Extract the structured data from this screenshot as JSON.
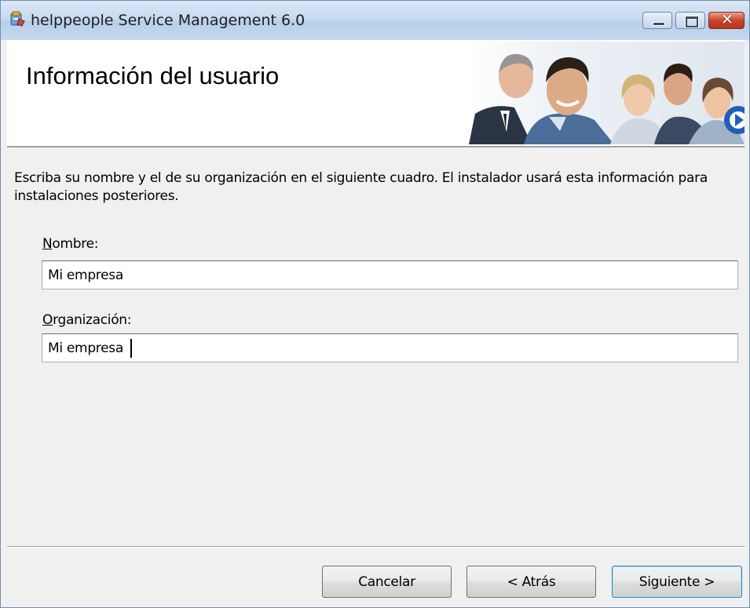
{
  "window": {
    "title": "helppeople Service Management 6.0"
  },
  "banner": {
    "title": "Información del usuario"
  },
  "instructions": "Escriba su nombre y el de su organización en el siguiente cuadro. El instalador usará esta información para instalaciones posteriores.",
  "form": {
    "name_label": {
      "accel": "N",
      "rest": "ombre:"
    },
    "name_value": "Mi empresa",
    "org_label": {
      "accel": "O",
      "rest": "rganización:"
    },
    "org_value": "Mi empresa"
  },
  "buttons": {
    "cancel": "Cancelar",
    "back": "< Atrás",
    "next": "Siguiente >"
  },
  "colors": {
    "window_border": "#6f8fb6",
    "close_button": "#c9452b",
    "dialog_background": "#f0f0f0",
    "default_button_border": "#3c7fb1"
  }
}
